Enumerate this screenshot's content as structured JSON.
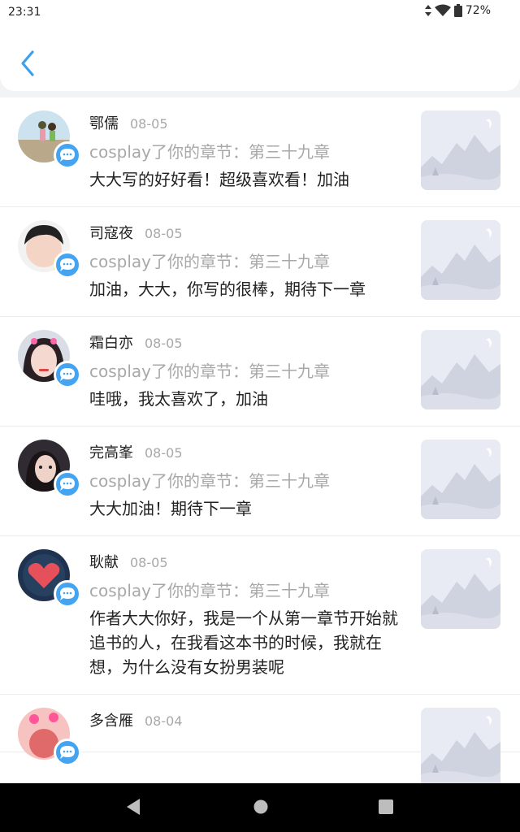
{
  "status": {
    "time": "23:31",
    "battery": "72%"
  },
  "header": {
    "back_icon": "chevron-left-icon"
  },
  "notifications": [
    {
      "name": "鄂儒",
      "date": "08-05",
      "action": "cosplay了你的章节：第三十九章",
      "comment": "大大写的好好看！超级喜欢看！加油"
    },
    {
      "name": "司寇夜",
      "date": "08-05",
      "action": "cosplay了你的章节：第三十九章",
      "comment": "加油，大大，你写的很棒，期待下一章"
    },
    {
      "name": "霜白亦",
      "date": "08-05",
      "action": "cosplay了你的章节：第三十九章",
      "comment": "哇哦，我太喜欢了，加油"
    },
    {
      "name": "完高峯",
      "date": "08-05",
      "action": "cosplay了你的章节：第三十九章",
      "comment": "大大加油！期待下一章"
    },
    {
      "name": "耿献",
      "date": "08-05",
      "action": "cosplay了你的章节：第三十九章",
      "comment": "作者大大你好，我是一个从第一章节开始就追书的人，在我看这本书的时候，我就在想，为什么没有女扮男装呢"
    },
    {
      "name": "多含雁",
      "date": "08-04",
      "action": "",
      "comment": ""
    }
  ],
  "colors": {
    "accent": "#44a4f2",
    "muted": "#a8a8a8",
    "text": "#222222"
  }
}
